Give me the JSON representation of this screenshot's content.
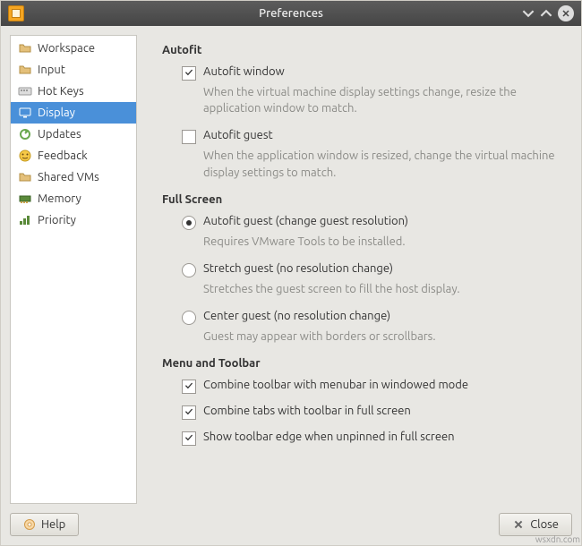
{
  "window": {
    "title": "Preferences"
  },
  "sidebar": {
    "items": [
      {
        "label": "Workspace",
        "icon": "folder-icon"
      },
      {
        "label": "Input",
        "icon": "folder-icon"
      },
      {
        "label": "Hot Keys",
        "icon": "keyboard-icon"
      },
      {
        "label": "Display",
        "icon": "monitor-icon"
      },
      {
        "label": "Updates",
        "icon": "updates-icon"
      },
      {
        "label": "Feedback",
        "icon": "face-icon"
      },
      {
        "label": "Shared VMs",
        "icon": "folder-icon"
      },
      {
        "label": "Memory",
        "icon": "memory-icon"
      },
      {
        "label": "Priority",
        "icon": "priority-icon"
      }
    ],
    "selected_index": 3
  },
  "sections": {
    "autofit": {
      "title": "Autofit",
      "window_option": {
        "label": "Autofit window",
        "checked": true,
        "description": "When the virtual machine display settings change, resize the application window to match."
      },
      "guest_option": {
        "label": "Autofit guest",
        "checked": false,
        "description": "When the application window is resized, change the virtual machine display settings to match."
      }
    },
    "fullscreen": {
      "title": "Full Screen",
      "autofit": {
        "label": "Autofit guest (change guest resolution)",
        "description": "Requires VMware Tools to be installed.",
        "selected": true
      },
      "stretch": {
        "label": "Stretch guest (no resolution change)",
        "description": "Stretches the guest screen to fill the host display.",
        "selected": false
      },
      "center": {
        "label": "Center guest (no resolution change)",
        "description": "Guest may appear with borders or scrollbars.",
        "selected": false
      }
    },
    "menu_toolbar": {
      "title": "Menu and Toolbar",
      "combine_menubar": {
        "label": "Combine toolbar with menubar in windowed mode",
        "checked": true
      },
      "combine_tabs": {
        "label": "Combine tabs with toolbar in full screen",
        "checked": true
      },
      "show_edge": {
        "label": "Show toolbar edge when unpinned in full screen",
        "checked": true
      }
    }
  },
  "footer": {
    "help_label": "Help",
    "close_label": "Close"
  },
  "watermark": "wsxdn.com"
}
